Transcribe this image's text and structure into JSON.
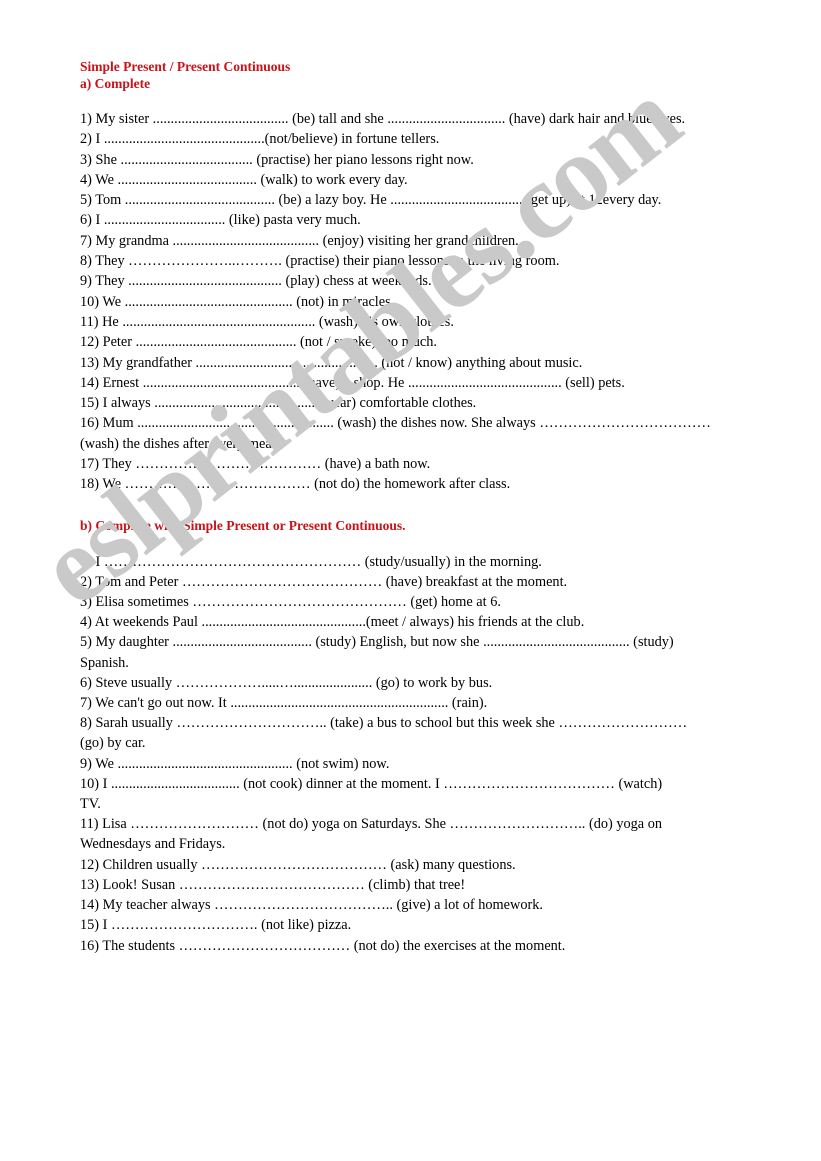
{
  "document": {
    "title": "Simple Present / Present Continuous",
    "watermark": "eslprintables.com",
    "watermark_color": "#c9c9c9",
    "heading_color": "#c6141a",
    "body_color": "#000000",
    "page_background": "#ffffff"
  },
  "section_a": {
    "heading_title": "Simple Present / Present Continuous",
    "heading_instruction": "a) Complete",
    "items": [
      "1) My sister ...................................... (be) tall and she ................................. (have) dark hair and blue eyes.",
      "2) I .............................................(not/believe) in fortune tellers.",
      "3) She ..................................... (practise) her piano lessons right now.",
      "4) We ....................................... (walk) to work every day.",
      "5) Tom .......................................... (be) a lazy boy. He ..................................... (get up) at 12every day.",
      "6) I .................................. (like) pasta very much.",
      "7) My grandma ......................................... (enjoy) visiting her grandchildren.",
      "8) They …………………..………. (practise) their piano lessons in the living room.",
      "9) They ........................................... (play) chess at weekends.",
      "10) We ............................................... (not) in miracles.",
      "11) He ...................................................... (wash) his own clothes.",
      "12) Peter ............................................. (not / smoke) too much.",
      "13) My grandfather ................................................... (not / know) anything about music.",
      "14) Ernest ............................................ (have) a shop. He ........................................... (sell) pets.",
      "15) I always ............................................. (wear)  comfortable clothes.",
      "16) Mum ....................................................... (wash) the dishes now. She always ………………………………",
      "(wash) the dishes after every meal.",
      "17) They ………………………………… (have) a bath now.",
      "18) We ………………………………… (not do) the homework after class."
    ]
  },
  "section_b": {
    "heading_instruction": "b) Complete with Simple Present or Present Continuous.",
    "items": [
      "1) I ……………………………………………… (study/usually) in the morning.",
      "2) Tom and Peter …………………………………… (have) breakfast at the moment.",
      "3) Elisa sometimes ……………………………………… (get) home at 6.",
      "4) At weekends Paul ..............................................(meet / always) his friends at the club.",
      "5) My daughter ....................................... (study) English, but now she ......................................... (study)",
      "Spanish.",
      "6) Steve usually ……………….....…...................... (go) to work by bus.",
      "7) We can't go out now. It ............................................................. (rain).",
      "8) Sarah usually ………………………….. (take) a bus to school but this week she ………………………",
      "(go) by car.",
      "9) We ................................................. (not swim) now.",
      "10) I .................................... (not cook) dinner at the moment. I ……………………………… (watch)",
      "TV.",
      "11) Lisa ……………………… (not do) yoga on Saturdays. She ……………………….. (do) yoga on",
      "Wednesdays and Fridays.",
      "12) Children usually ………………………………… (ask) many questions.",
      "13) Look! Susan ………………………………… (climb) that tree!",
      "14) My teacher always ……………………………….. (give) a lot of homework.",
      "15) I …………………………. (not like) pizza.",
      "16) The students ……………………………… (not do) the exercises at the moment."
    ]
  }
}
